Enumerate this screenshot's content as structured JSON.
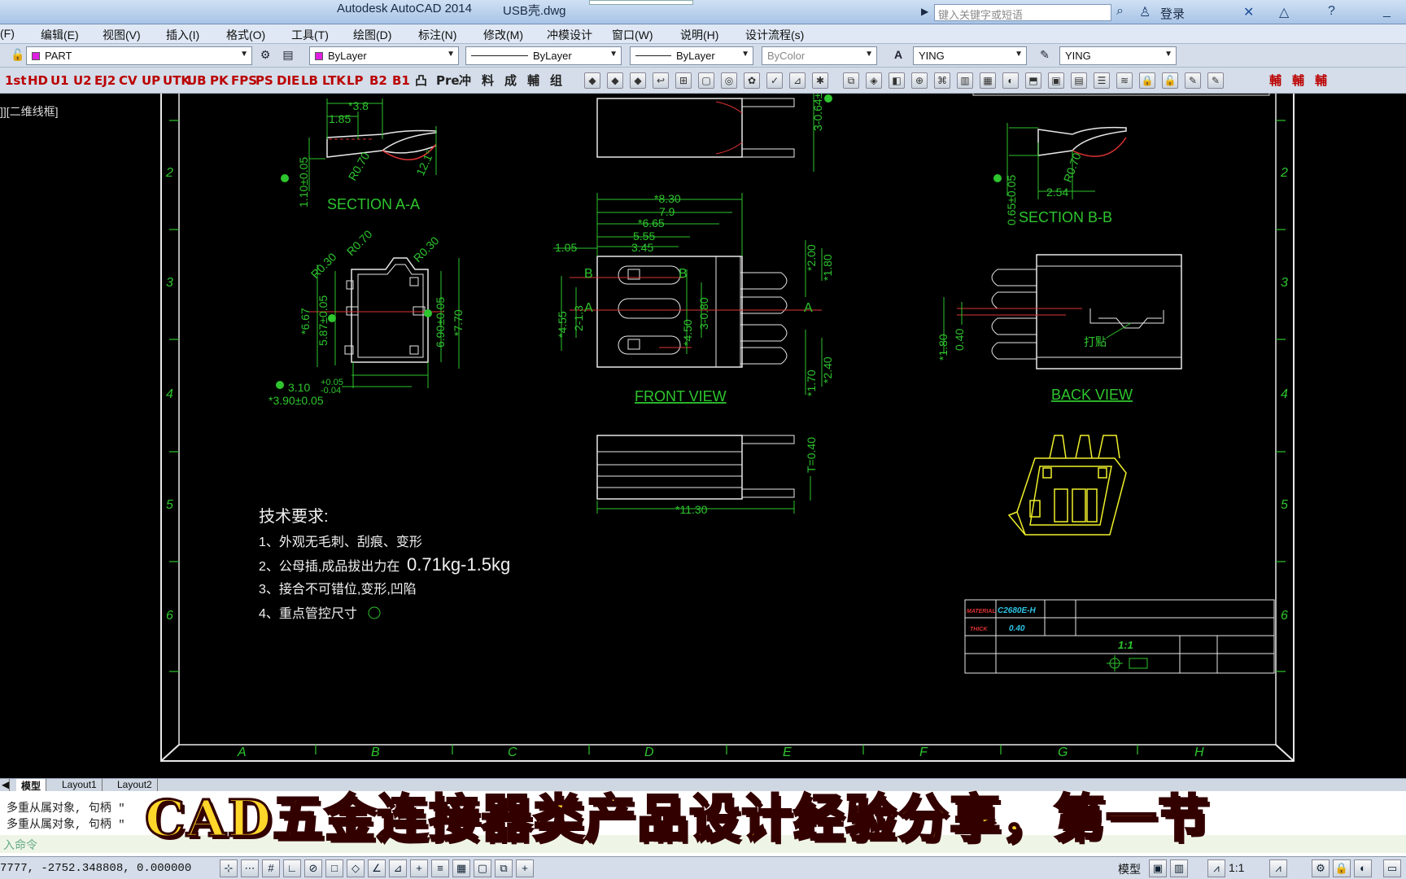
{
  "window": {
    "app_title": "Autodesk AutoCAD 2014",
    "doc_name": "USB壳.dwg",
    "search_placeholder": "键入关键字或短语",
    "login": "登录"
  },
  "menu": [
    "(F)",
    "编辑(E)",
    "视图(V)",
    "插入(I)",
    "格式(O)",
    "工具(T)",
    "绘图(D)",
    "标注(N)",
    "修改(M)",
    "冲模设计",
    "窗口(W)",
    "说明(H)",
    "设计流程(s)"
  ],
  "properties": {
    "layer": "PART",
    "color": "ByLayer",
    "linetype": "ByLayer",
    "lineweight": "ByLayer",
    "plotstyle": "ByColor",
    "text_style": "YING",
    "dim_style": "YING"
  },
  "command_buttons": [
    "1st",
    "HD",
    "U1",
    "U2",
    "EJ2",
    "CV",
    "UP",
    "UTK",
    "UB",
    "PK",
    "FPS",
    "PS",
    "DIE",
    "LB",
    "LTK",
    "LP",
    "B2",
    "B1",
    "凸",
    "Pre",
    "冲",
    "料",
    "成",
    "輔",
    "组"
  ],
  "right_buttons": [
    "輔",
    "輔",
    "輔"
  ],
  "viewport_label": "]][二维线框]",
  "drawing": {
    "section_aa": {
      "title": "SECTION A-A",
      "dims": [
        "*3.8",
        "1.85",
        "R0.70",
        "12.1°",
        "1.10±0.05"
      ]
    },
    "section_bb": {
      "title": "SECTION B-B",
      "dims": [
        "0.65±0.05",
        "R0.70",
        "2.54"
      ]
    },
    "end_view": {
      "dims": [
        "R0.30",
        "R0.70",
        "R0.30",
        "*6.67",
        "5.87±0.05",
        "6.90±0.05",
        "*7.70",
        "3.10",
        "+0.05",
        "-0.04",
        "*3.90±0.05"
      ]
    },
    "front_view": {
      "title": "FRONT VIEW",
      "dims": [
        "*8.30",
        "7.9",
        "*6.65",
        "5.55",
        "3.45",
        "1.05",
        "*2.00",
        "*1.80",
        "*4.55",
        "2-1.3",
        "*4.50",
        "3-0.80",
        "*1.70",
        "*2.40"
      ],
      "marks": [
        "B",
        "B",
        "A",
        "A"
      ]
    },
    "top_view": {
      "dims": [
        "3-0.64±",
        "T=0.40",
        "*11.30"
      ]
    },
    "back_view": {
      "title": "BACK VIEW",
      "dims": [
        "*1.80",
        "0.40"
      ],
      "note": "打點"
    },
    "notes": {
      "heading": "技术要求:",
      "items": [
        "1、外观无毛刺、刮痕、变形",
        "2、公母插,成品拔出力在",
        "3、接合不可错位,变形,凹陷",
        "4、重点管控尺寸"
      ],
      "force_value": "0.71kg-1.5kg"
    },
    "frame": {
      "col_labels": [
        "A",
        "B",
        "C",
        "D",
        "E",
        "F",
        "G",
        "H"
      ],
      "row_labels": [
        "2",
        "3",
        "4",
        "5",
        "6"
      ]
    },
    "title_block": {
      "material_label": "MATERIAL",
      "material": "C2680E-H",
      "thick_label": "THICK",
      "thick": "0.40",
      "scale": "1:1"
    }
  },
  "layout_tabs": [
    "模型",
    "Layout1",
    "Layout2"
  ],
  "command_history": [
    "多重从属对象, 句柄 \"",
    "多重从属对象, 句柄 \""
  ],
  "command_prompt": "入命令",
  "caption": "CAD五金连接器类产品设计经验分享，第一节",
  "status": {
    "coords": "7777, -2752.348808, 0.000000",
    "model_label": "模型",
    "scale_label": "1:1"
  }
}
